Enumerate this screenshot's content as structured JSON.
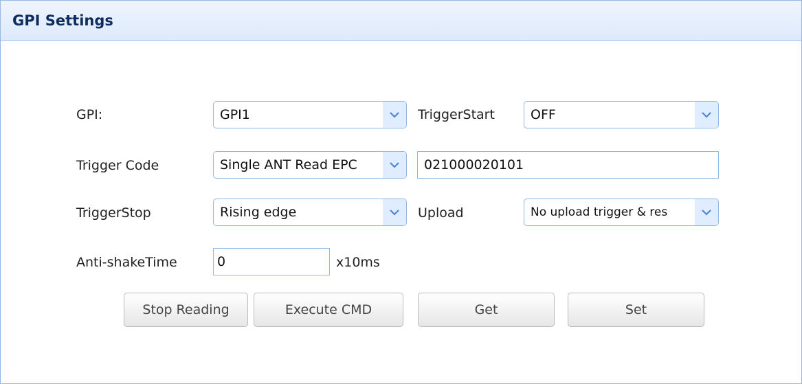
{
  "panel": {
    "title": "GPI Settings"
  },
  "form": {
    "gpi": {
      "label": "GPI:",
      "value": "GPI1"
    },
    "trigger_start": {
      "label": "TriggerStart",
      "value": "OFF"
    },
    "trigger_code": {
      "label": "Trigger Code",
      "value": "Single ANT Read EPC",
      "text_value": "021000020101"
    },
    "trigger_stop": {
      "label": "TriggerStop",
      "value": "Rising edge"
    },
    "upload": {
      "label": "Upload",
      "value": "No upload trigger & res"
    },
    "anti_shake": {
      "label": "Anti-shakeTime",
      "value": "0",
      "unit": "x10ms"
    }
  },
  "buttons": {
    "stop_reading": "Stop Reading",
    "execute_cmd": "Execute CMD",
    "get": "Get",
    "set": "Set"
  },
  "icons": {
    "combo_arrow": "chevron-down-icon"
  },
  "colors": {
    "border": "#95b8e7",
    "header_bg": "#e0ecff",
    "title": "#0e2d5f"
  }
}
